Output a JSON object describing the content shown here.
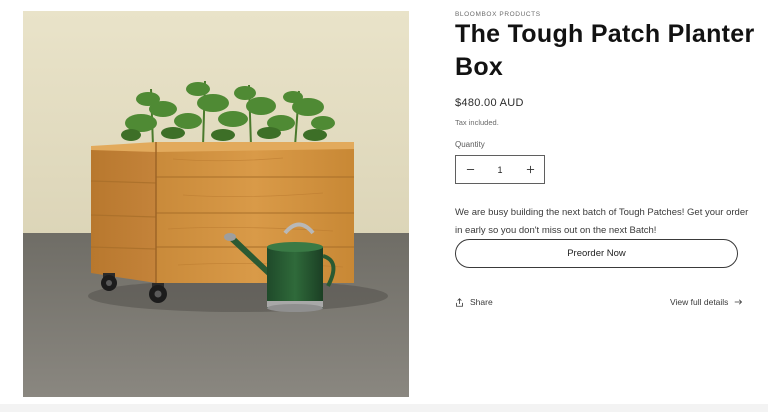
{
  "product": {
    "image_alt": "planter-box-photo",
    "vendor": "BLOOMBOX PRODUCTS",
    "title": "The Tough Patch Planter Box",
    "price": "$480.00 AUD",
    "tax_note": "Tax included."
  },
  "quantity": {
    "label": "Quantity",
    "value": "1",
    "minus_icon": "minus-icon",
    "plus_icon": "plus-icon"
  },
  "message": "We are busy building the next batch of Tough Patches! Get your order in early so you don't miss out on the next Batch!",
  "actions": {
    "preorder_label": "Preorder Now",
    "share_label": "Share",
    "share_icon": "share-icon",
    "view_full_label": "View full details",
    "view_full_icon": "arrow-right-icon"
  }
}
